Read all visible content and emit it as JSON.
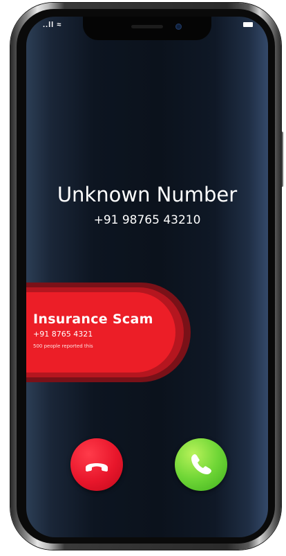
{
  "status_bar": {
    "signal_text": "..ll ≈"
  },
  "call": {
    "caller_name": "Unknown Number",
    "caller_number": "+91 98765 43210"
  },
  "scam_banner": {
    "title": "Insurance Scam",
    "number": "+91 8765 4321",
    "reports": "500 people reported this"
  },
  "actions": {
    "decline_icon": "phone-hangup-icon",
    "accept_icon": "phone-icon"
  },
  "colors": {
    "decline": "#e8162b",
    "accept": "#6fd636",
    "banner": "#ec1e27"
  }
}
